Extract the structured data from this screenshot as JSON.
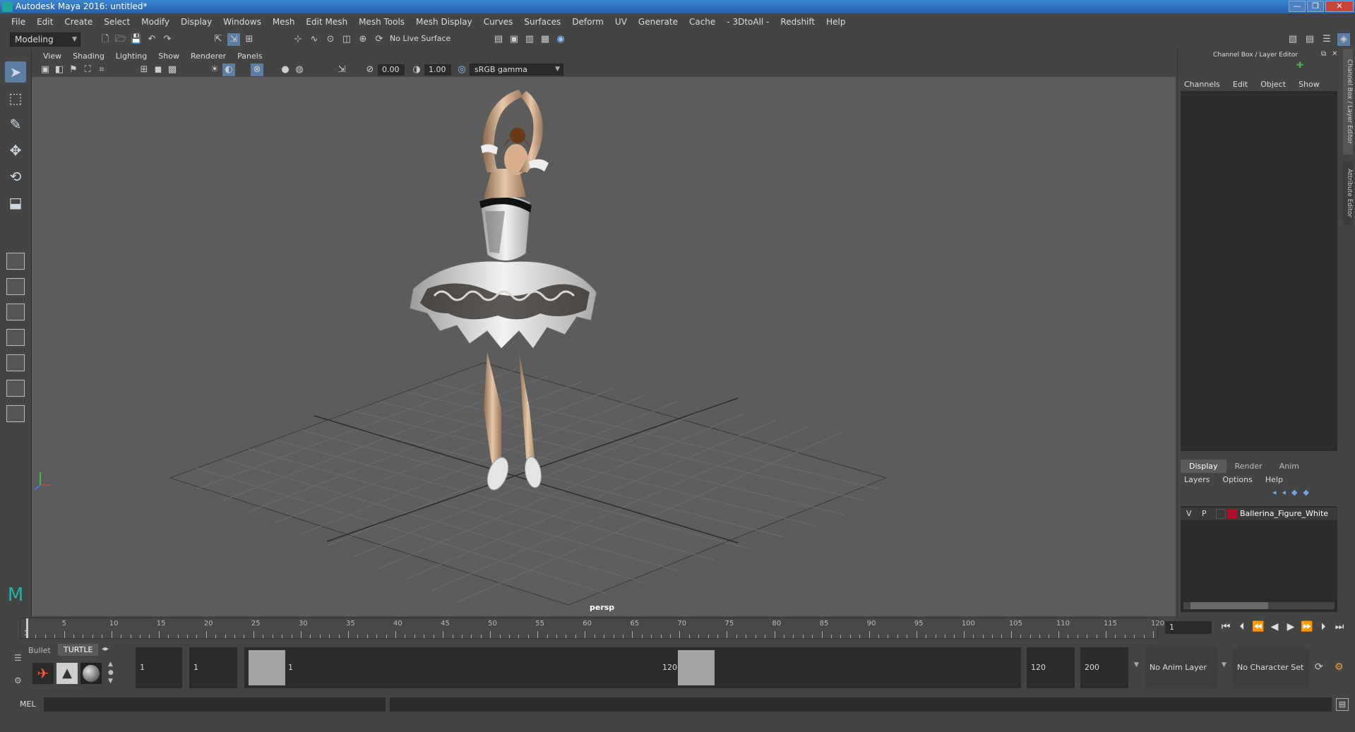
{
  "window": {
    "title": "Autodesk Maya 2016: untitled*",
    "controls": [
      "—",
      "❐",
      "✕"
    ]
  },
  "menu": [
    "File",
    "Edit",
    "Create",
    "Select",
    "Modify",
    "Display",
    "Windows",
    "Mesh",
    "Edit Mesh",
    "Mesh Tools",
    "Mesh Display",
    "Curves",
    "Surfaces",
    "Deform",
    "UV",
    "Generate",
    "Cache",
    "- 3DtoAll -",
    "Redshift",
    "Help"
  ],
  "toolbar": {
    "mode": "Modeling",
    "live_surface": "No Live Surface"
  },
  "viewport_menu": [
    "View",
    "Shading",
    "Lighting",
    "Show",
    "Renderer",
    "Panels"
  ],
  "viewport_tools": {
    "exposure": "0.00",
    "gamma": "1.00",
    "color_space": "sRGB gamma"
  },
  "viewport": {
    "camera": "persp"
  },
  "channel_box": {
    "title": "Channel Box / Layer Editor",
    "menu": [
      "Channels",
      "Edit",
      "Object",
      "Show"
    ],
    "side_tabs": [
      "Channel Box / Layer Editor",
      "Attribute Editor"
    ]
  },
  "layer_editor": {
    "tabs": [
      "Display",
      "Render",
      "Anim"
    ],
    "menu": [
      "Layers",
      "Options",
      "Help"
    ],
    "layers": [
      {
        "v": "V",
        "p": "P",
        "name": "Ballerina_Figure_White",
        "color": "#b0102a"
      }
    ]
  },
  "timeline": {
    "labels": [
      "1",
      "5",
      "10",
      "15",
      "20",
      "25",
      "30",
      "35",
      "40",
      "45",
      "50",
      "55",
      "60",
      "65",
      "70",
      "75",
      "80",
      "85",
      "90",
      "95",
      "100",
      "105",
      "110",
      "115",
      "120"
    ],
    "current_frame": "1"
  },
  "range": {
    "shelf_tabs": [
      "Bullet",
      "TURTLE"
    ],
    "start": "1",
    "anim_start": "1",
    "range_start": "1",
    "range_end": "120",
    "anim_end": "120",
    "end": "200",
    "anim_layer": "No Anim Layer",
    "character_set": "No Character Set"
  },
  "command_line": {
    "label": "MEL"
  }
}
